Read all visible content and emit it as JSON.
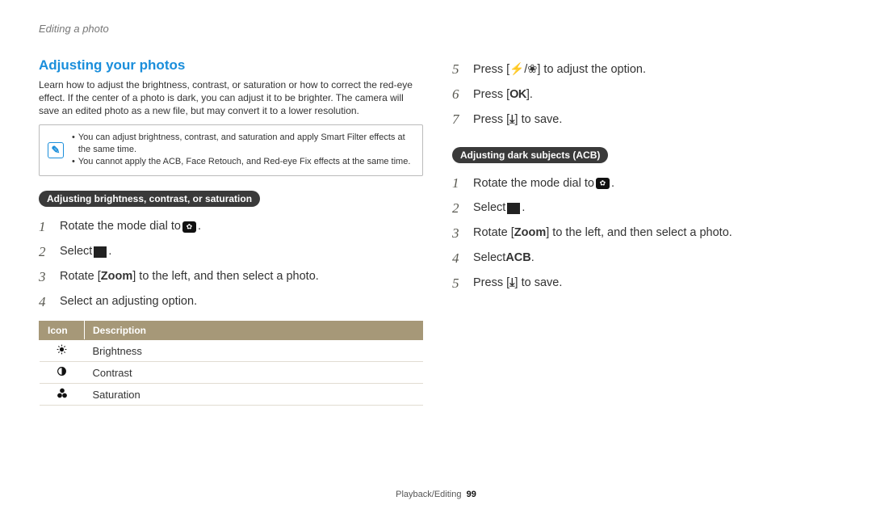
{
  "header": "Editing a photo",
  "left": {
    "title": "Adjusting your photos",
    "intro": "Learn how to adjust the brightness, contrast, or saturation or how to correct the red-eye effect. If the center of a photo is dark, you can adjust it to be brighter. The camera will save an edited photo as a new file, but may convert it to a lower resolution.",
    "notes": [
      "You can adjust brightness, contrast, and saturation and apply Smart Filter effects at the same time.",
      "You cannot apply the ACB, Face Retouch, and Red-eye Fix effects at the same time."
    ],
    "subA": "Adjusting brightness, contrast, or saturation",
    "stepsA": {
      "s1a": "Rotate the mode dial to ",
      "s1b": ".",
      "s2a": "Select ",
      "s2b": ".",
      "s3a": "Rotate [",
      "s3bold": "Zoom",
      "s3b": "] to the left, and then select a photo.",
      "s4": "Select an adjusting option."
    },
    "table": {
      "h1": "Icon",
      "h2": "Description",
      "r1": "Brightness",
      "r2": "Contrast",
      "r3": "Saturation"
    }
  },
  "right": {
    "contA": {
      "s5a": "Press [",
      "s5b": "/",
      "s5c": "] to adjust the option.",
      "s6a": "Press [",
      "s6b": "].",
      "s7a": "Press [",
      "s7b": "] to save."
    },
    "subB": "Adjusting dark subjects (ACB)",
    "stepsB": {
      "s1a": "Rotate the mode dial to ",
      "s1b": ".",
      "s2a": "Select ",
      "s2b": ".",
      "s3a": "Rotate [",
      "s3bold": "Zoom",
      "s3b": "] to the left, and then select a photo.",
      "s4a": "Select ",
      "s4bold": "ACB",
      "s4b": ".",
      "s5a": "Press [",
      "s5b": "] to save."
    }
  },
  "footer": {
    "section": "Playback/Editing",
    "page": "99"
  },
  "keys": {
    "flash": "⚡",
    "macro": "❀",
    "ok": "OK",
    "menu": "⤓"
  }
}
